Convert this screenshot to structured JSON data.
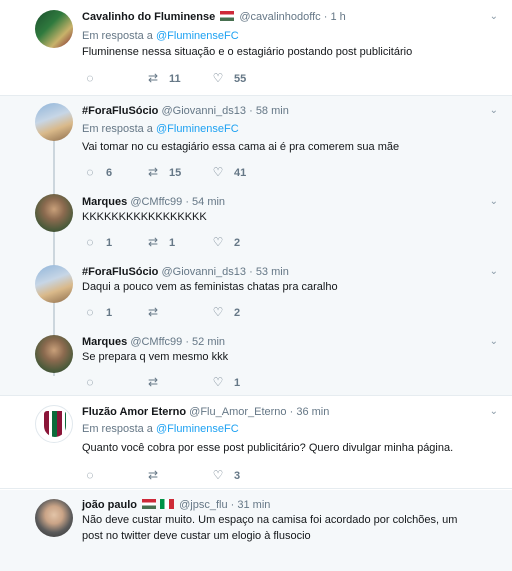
{
  "tweets": [
    {
      "name": "Cavalinho do Fluminense",
      "flag": "hungary",
      "handle": "@cavalinhodoffc",
      "time": "· 1 h",
      "reply_prefix": "Em resposta a",
      "reply_to": "@FluminenseFC",
      "text": "Fluminense nessa situação e o estagiário postando post publicitário",
      "replies": "",
      "retweets": "11",
      "likes": "55"
    },
    {
      "name": "#ForaFluSócio",
      "handle": "@Giovanni_ds13",
      "time": "· 58 min",
      "reply_prefix": "Em resposta a",
      "reply_to": "@FluminenseFC",
      "text": "Vai tomar no cu estagiário essa cama ai é pra comerem sua mãe",
      "replies": "6",
      "retweets": "15",
      "likes": "41"
    },
    {
      "name": "Marques",
      "handle": "@CMffc99",
      "time": "· 54 min",
      "text": "KKKKKKKKKKKKKKKKK",
      "replies": "1",
      "retweets": "1",
      "likes": "2"
    },
    {
      "name": "#ForaFluSócio",
      "handle": "@Giovanni_ds13",
      "time": "· 53 min",
      "text": "Daqui a pouco vem as feministas chatas pra caralho",
      "replies": "1",
      "retweets": "",
      "likes": "2"
    },
    {
      "name": "Marques",
      "handle": "@CMffc99",
      "time": "· 52 min",
      "text": "Se prepara q vem mesmo kkk",
      "replies": "",
      "retweets": "",
      "likes": "1"
    },
    {
      "name": "Fluzão Amor Eterno",
      "handle": "@Flu_Amor_Eterno",
      "time": "· 36 min",
      "reply_prefix": "Em resposta a",
      "reply_to": "@FluminenseFC",
      "text": "Quanto você cobra por esse post publicitário? Quero divulgar minha página.",
      "replies": "",
      "retweets": "",
      "likes": "3"
    },
    {
      "name": "joão paulo",
      "flags": [
        "hungary",
        "italy"
      ],
      "handle": "@jpsc_flu",
      "time": "· 31 min",
      "text_line1": "Não deve custar muito. Um espaço na camisa foi acordado por colchões, um",
      "text_line2": "post no twitter deve custar um elogio à flusocio"
    }
  ],
  "icons": {
    "reply": "reply-icon",
    "retweet": "retweet-icon",
    "like": "heart-icon",
    "more": "chevron-down-icon"
  },
  "colors": {
    "link": "#1da1f2",
    "muted": "#657786",
    "thread_bg": "#f5f8fa"
  }
}
